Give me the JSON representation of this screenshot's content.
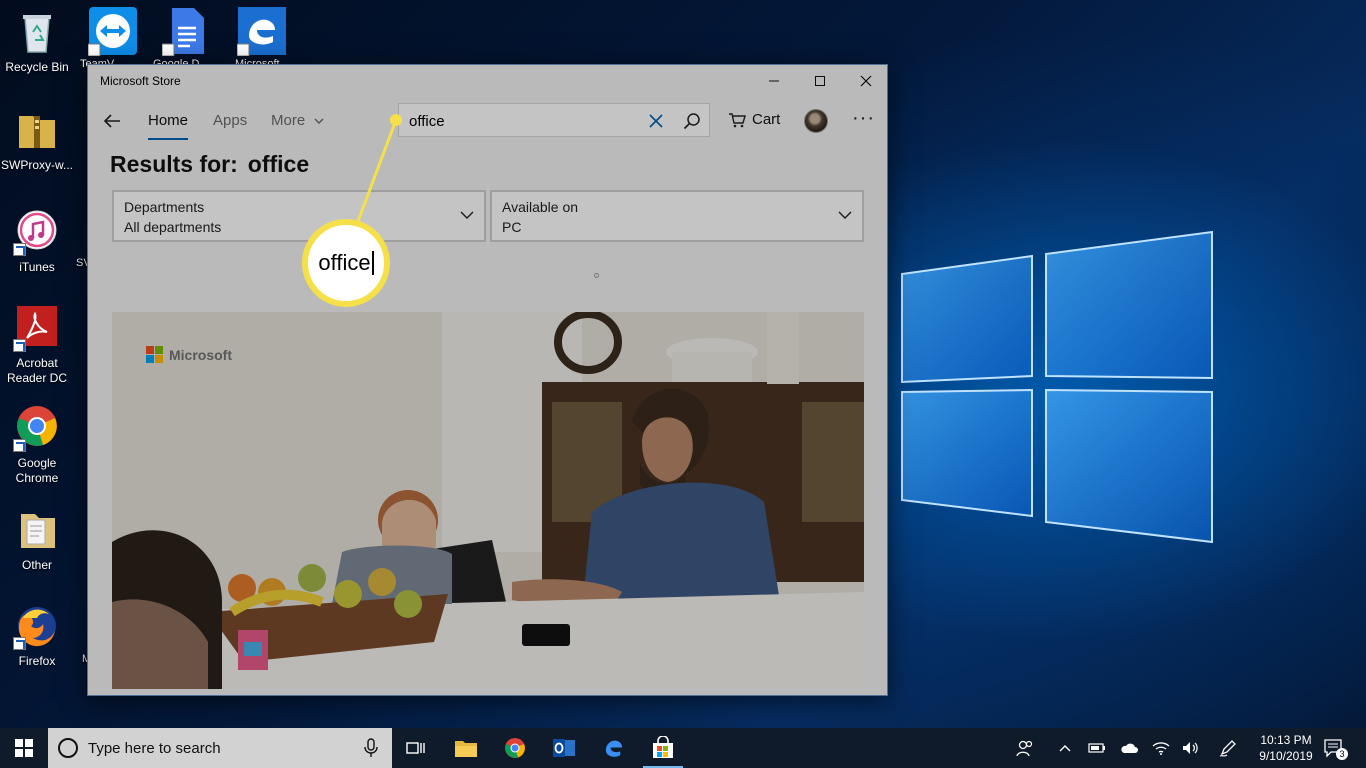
{
  "desktop": {
    "icons": [
      {
        "label": "Recycle Bin",
        "icon": "recycle-bin-icon"
      },
      {
        "label": "SWProxy-w...",
        "icon": "zip-folder-icon"
      },
      {
        "label": "iTunes",
        "icon": "itunes-icon"
      },
      {
        "label": "Acrobat Reader DC",
        "icon": "acrobat-icon"
      },
      {
        "label": "Google Chrome",
        "icon": "chrome-icon"
      },
      {
        "label": "Other",
        "icon": "document-folder-icon"
      },
      {
        "label": "Firefox",
        "icon": "firefox-icon"
      }
    ],
    "top_row_labels": [
      "TeamV",
      "Google D",
      "Microsoft"
    ],
    "peek_labels": [
      "SV",
      "M"
    ]
  },
  "store": {
    "title": "Microsoft Store",
    "nav": {
      "home": "Home",
      "apps": "Apps",
      "more": "More"
    },
    "search": {
      "value": "office"
    },
    "cart_label": "Cart",
    "more_dots": "···",
    "results_prefix": "Results for:",
    "results_query": "office",
    "filters": [
      {
        "label": "Departments",
        "value": "All departments"
      },
      {
        "label": "Available on",
        "value": "PC"
      }
    ],
    "hero_brand": "Microsoft"
  },
  "callout": {
    "text": "office",
    "color": "#f6e04a"
  },
  "taskbar": {
    "search_placeholder": "Type here to search",
    "time": "10:13 PM",
    "date": "9/10/2019",
    "notification_count": "3"
  },
  "colors": {
    "accent": "#0063b1",
    "taskbar": "#0f1a2a"
  }
}
